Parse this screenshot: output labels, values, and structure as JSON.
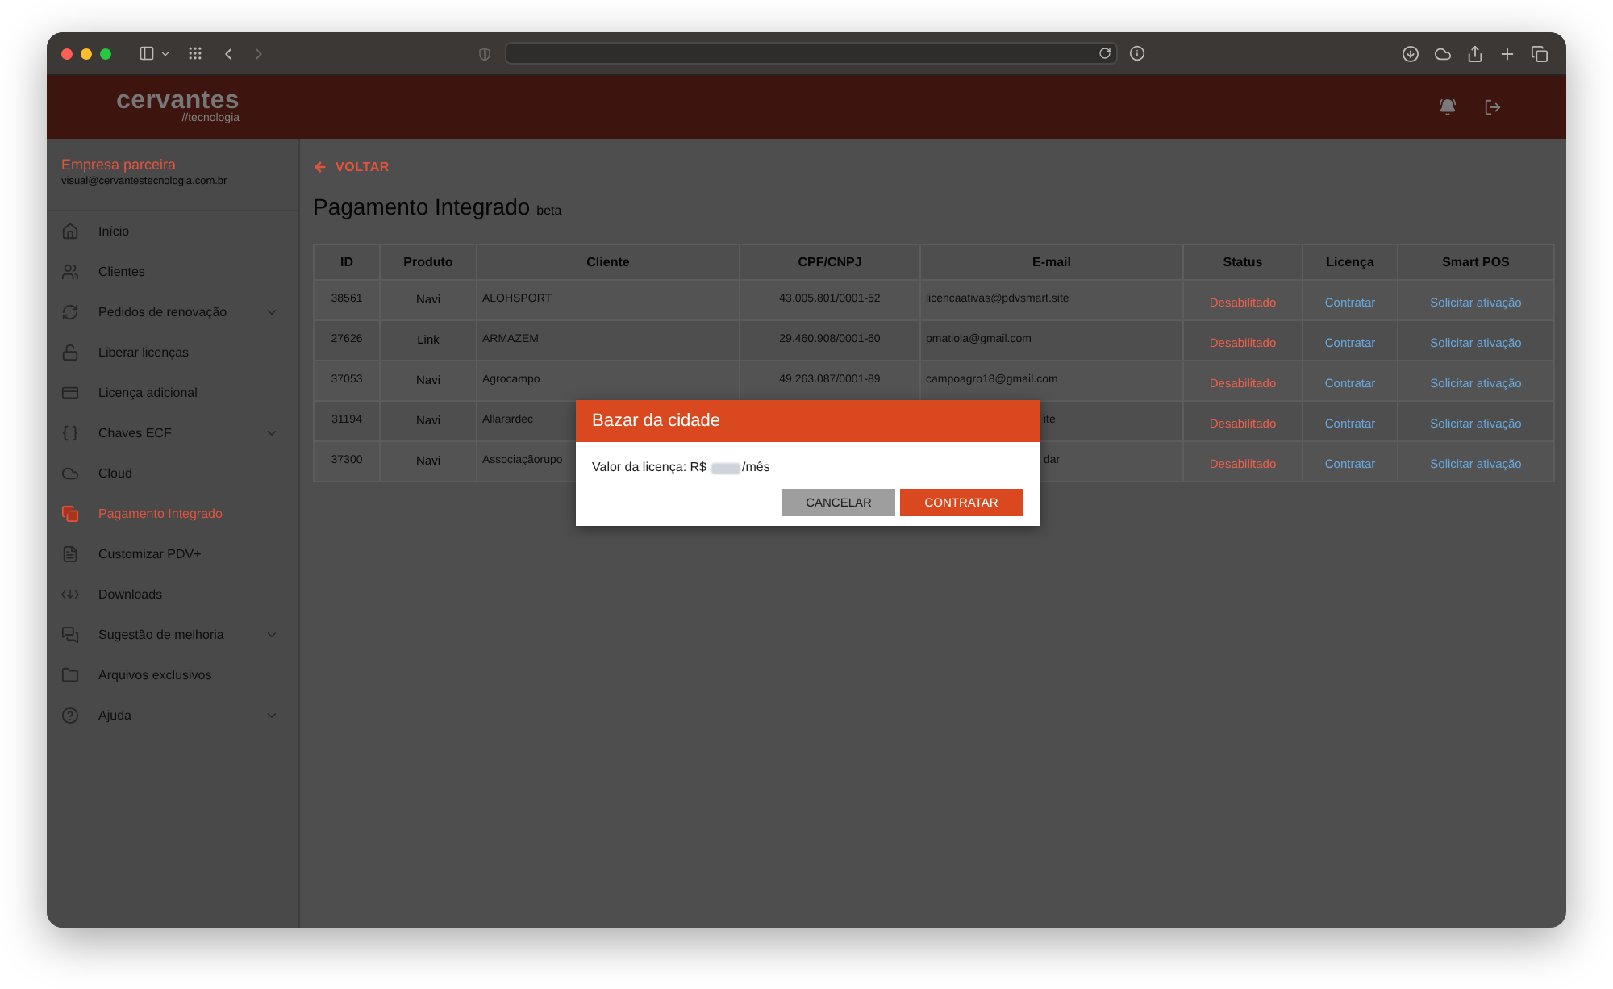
{
  "header": {
    "logo_name": "cervantes",
    "logo_tagline": "//tecnologia"
  },
  "sidebar": {
    "company": "Empresa parceira",
    "email": "visual@cervantestecnologia.com.br",
    "items": [
      {
        "label": "Início",
        "selected": false,
        "expandable": false
      },
      {
        "label": "Clientes",
        "selected": false,
        "expandable": false
      },
      {
        "label": "Pedidos de renovação",
        "selected": false,
        "expandable": true
      },
      {
        "label": "Liberar licenças",
        "selected": false,
        "expandable": false
      },
      {
        "label": "Licença adicional",
        "selected": false,
        "expandable": false
      },
      {
        "label": "Chaves ECF",
        "selected": false,
        "expandable": true
      },
      {
        "label": "Cloud",
        "selected": false,
        "expandable": false
      },
      {
        "label": "Pagamento Integrado",
        "selected": true,
        "expandable": false
      },
      {
        "label": "Customizar PDV+",
        "selected": false,
        "expandable": false
      },
      {
        "label": "Downloads",
        "selected": false,
        "expandable": false
      },
      {
        "label": "Sugestão de melhoria",
        "selected": false,
        "expandable": true
      },
      {
        "label": "Arquivos exclusivos",
        "selected": false,
        "expandable": false
      },
      {
        "label": "Ajuda",
        "selected": false,
        "expandable": true
      }
    ]
  },
  "back_link": "VOLTAR",
  "page": {
    "title": "Pagamento Integrado",
    "badge": "beta"
  },
  "table": {
    "columns": [
      "ID",
      "Produto",
      "Cliente",
      "CPF/CNPJ",
      "E-mail",
      "Status",
      "Licença",
      "Smart POS"
    ],
    "rows": [
      {
        "id": "38561",
        "product": "Navi",
        "client": "ALOHSPORT",
        "document": "43.005.801/0001-52",
        "email": "licencaativas@pdvsmart.site",
        "status": "Desabilitado",
        "enabled": false,
        "license": "Contratar",
        "smart_pos": "Solicitar ativação",
        "covered": false
      },
      {
        "id": "27626",
        "product": "Link",
        "client": "ARMAZEM",
        "document": "29.460.908/0001-60",
        "email": "pmatiola@gmail.com",
        "status": "Desabilitado",
        "enabled": false,
        "license": "Contratar",
        "smart_pos": "Solicitar ativação",
        "covered": false
      },
      {
        "id": "37053",
        "product": "Navi",
        "client": "Agrocampo",
        "document": "49.263.087/0001-89",
        "email": "campoagro18@gmail.com",
        "status": "Desabilitado",
        "enabled": false,
        "license": "Contratar",
        "smart_pos": "Solicitar ativação",
        "covered": false
      },
      {
        "id": "31194",
        "product": "Navi",
        "client": "Allarardec",
        "email": "ite",
        "status": "Desabilitado",
        "enabled": false,
        "license": "Contratar",
        "smart_pos": "Solicitar ativação",
        "covered": true
      },
      {
        "id": "37300",
        "product": "Navi",
        "client": "Associaçãorupo",
        "email": "dar",
        "status": "Desabilitado",
        "enabled": false,
        "license": "Contratar",
        "smart_pos": "Solicitar ativação",
        "covered": true
      }
    ]
  },
  "dialog": {
    "title": "Bazar da cidade",
    "value_label": "Valor da licença: R$",
    "value_suffix": "/mês",
    "buttons": [
      {
        "label": "CANCELAR",
        "kind": "secondary"
      },
      {
        "label": "CONTRATAR",
        "kind": "primary"
      }
    ]
  }
}
